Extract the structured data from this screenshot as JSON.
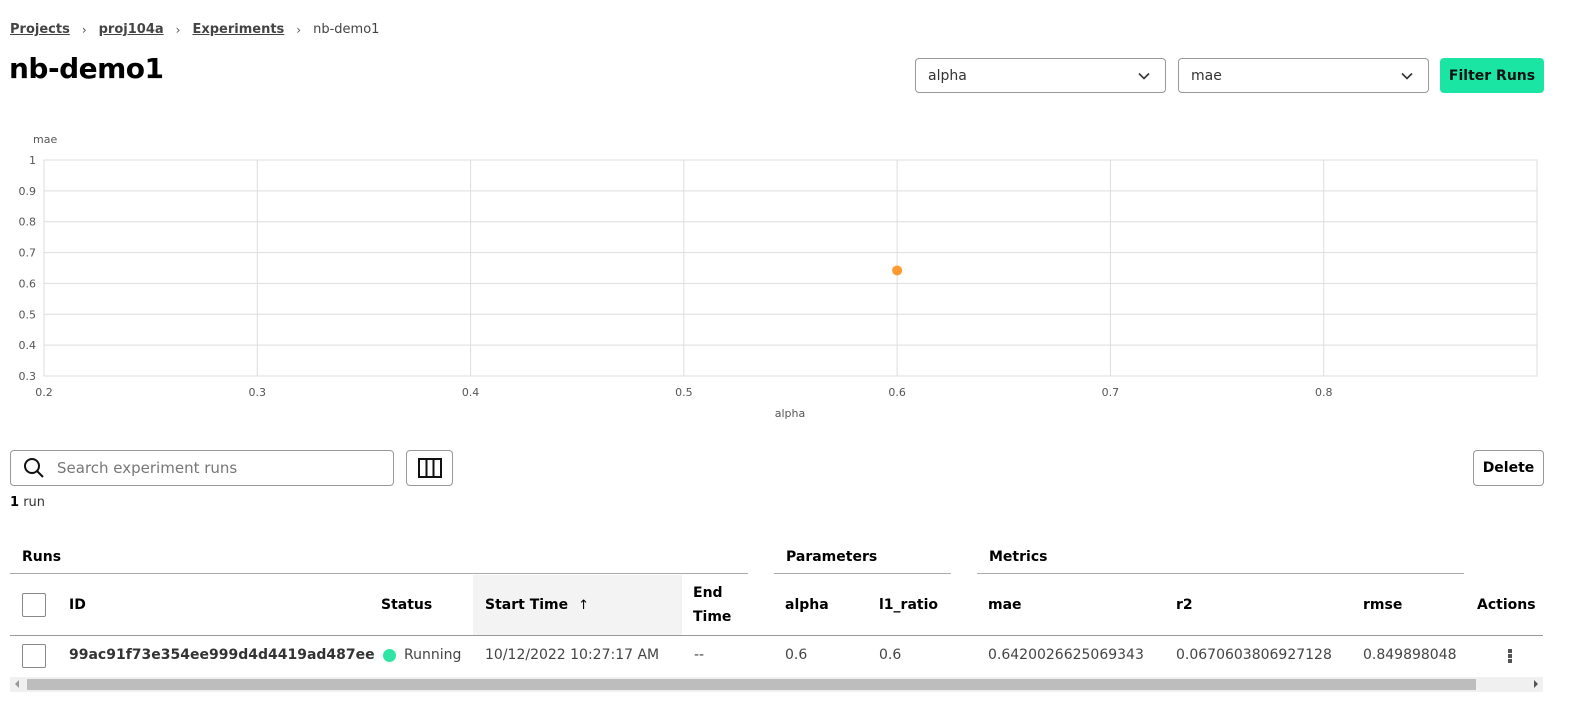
{
  "breadcrumb": {
    "items": [
      "Projects",
      "proj104a",
      "Experiments"
    ],
    "current": "nb-demo1"
  },
  "page_title": "nb-demo1",
  "controls": {
    "x_select": "alpha",
    "y_select": "mae",
    "filter_button": "Filter Runs"
  },
  "chart_data": {
    "type": "scatter",
    "title": "",
    "xlabel": "alpha",
    "ylabel": "mae",
    "xlim": [
      0.2,
      0.9
    ],
    "ylim": [
      0.3,
      1
    ],
    "x_ticks": [
      "0.2",
      "0.3",
      "0.4",
      "0.5",
      "0.6",
      "0.7",
      "0.8"
    ],
    "y_ticks": [
      "1",
      "0.9",
      "0.8",
      "0.7",
      "0.6",
      "0.5",
      "0.4",
      "0.3"
    ],
    "grid": true,
    "point_color": "#ff9a2e",
    "points": [
      {
        "x": 0.6,
        "y": 0.642
      }
    ]
  },
  "toolbar": {
    "search_placeholder": "Search experiment runs",
    "columns_icon": "columns-icon",
    "delete_button": "Delete"
  },
  "run_count": {
    "number": "1",
    "label": "run"
  },
  "table": {
    "groups": {
      "runs": "Runs",
      "parameters": "Parameters",
      "metrics": "Metrics"
    },
    "headers": {
      "id": "ID",
      "status": "Status",
      "start_time": "Start Time",
      "sort_indicator": "↑",
      "end_time_1": "End",
      "end_time_2": "Time",
      "alpha": "alpha",
      "l1_ratio": "l1_ratio",
      "mae": "mae",
      "r2": "r2",
      "rmse": "rmse",
      "actions": "Actions"
    },
    "rows": [
      {
        "id": "99ac91f73e354ee999d4d4419ad487ee",
        "status": "Running",
        "status_color": "#2ee5a5",
        "start_time": "10/12/2022 10:27:17 AM",
        "end_time": "--",
        "alpha": "0.6",
        "l1_ratio": "0.6",
        "mae": "0.6420026625069343",
        "r2": "0.0670603806927128",
        "rmse": "0.849898048"
      }
    ]
  }
}
